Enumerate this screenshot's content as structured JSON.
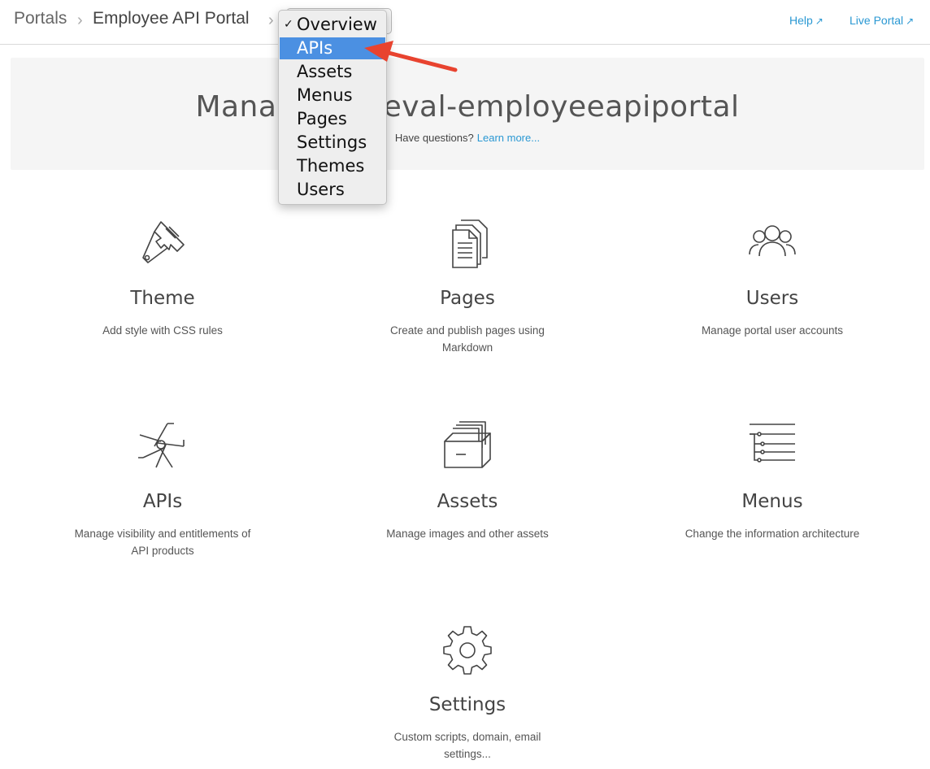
{
  "breadcrumb": {
    "root": "Portals",
    "portal": "Employee API Portal",
    "separator": "›"
  },
  "top_links": {
    "help": "Help",
    "live_portal": "Live Portal"
  },
  "banner": {
    "title_left": "Mana",
    "title_right": "e-eval-employeeapiportal",
    "question": "Have questions?",
    "learn_more": "Learn more..."
  },
  "dropdown": {
    "selected": "Overview",
    "highlighted": "APIs",
    "options": [
      "Overview",
      "APIs",
      "Assets",
      "Menus",
      "Pages",
      "Settings",
      "Themes",
      "Users"
    ]
  },
  "cards": [
    {
      "id": "theme",
      "title": "Theme",
      "desc": "Add style with CSS rules",
      "icon": "paintbrush-icon"
    },
    {
      "id": "pages",
      "title": "Pages",
      "desc": "Create and publish pages using Markdown",
      "icon": "documents-icon"
    },
    {
      "id": "users",
      "title": "Users",
      "desc": "Manage portal user accounts",
      "icon": "users-icon"
    },
    {
      "id": "apis",
      "title": "APIs",
      "desc": "Manage visibility and entitlements of API products",
      "icon": "aperture-icon"
    },
    {
      "id": "assets",
      "title": "Assets",
      "desc": "Manage images and other assets",
      "icon": "file-drawer-icon"
    },
    {
      "id": "menus",
      "title": "Menus",
      "desc": "Change the information architecture",
      "icon": "menu-tree-icon"
    },
    {
      "id": "settings",
      "title": "Settings",
      "desc": "Custom scripts, domain, email settings...",
      "icon": "gear-icon"
    }
  ],
  "colors": {
    "link": "#2a98d3",
    "highlight": "#4b90e2",
    "annotation_arrow": "#e8432f",
    "banner_bg": "#f5f5f5"
  }
}
